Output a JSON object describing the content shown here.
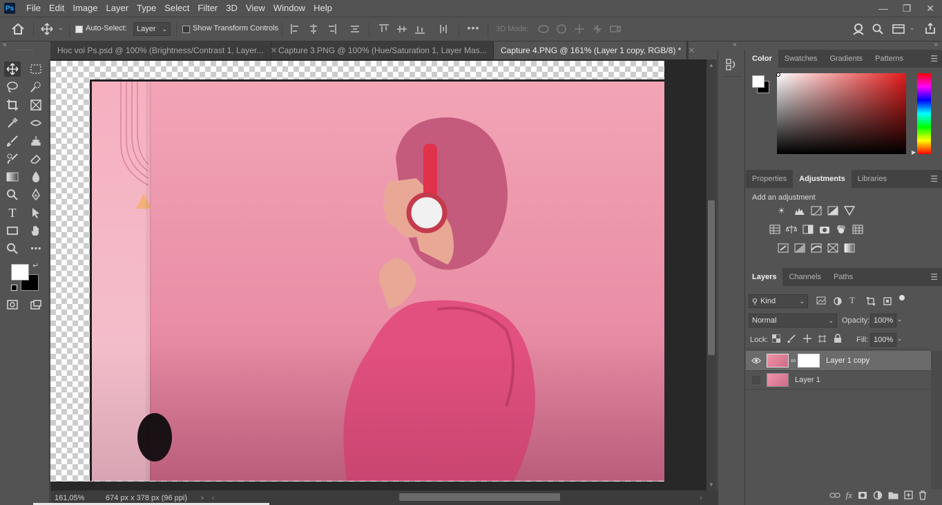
{
  "app": {
    "logo": "Ps"
  },
  "menu": [
    "File",
    "Edit",
    "Image",
    "Layer",
    "Type",
    "Select",
    "Filter",
    "3D",
    "View",
    "Window",
    "Help"
  ],
  "window_controls": [
    "minimize-icon",
    "restore-icon",
    "close-icon"
  ],
  "options": {
    "auto_select_label": "Auto-Select:",
    "auto_select_checked": true,
    "auto_select_target": "Layer",
    "show_transform_label": "Show Transform Controls",
    "show_transform_checked": false,
    "mode_3d_label": "3D Mode:"
  },
  "tabs": [
    {
      "label": "Hoc voi Ps.psd @ 100% (Brightness/Contrast 1, Layer...",
      "active": false
    },
    {
      "label": "Capture 3.PNG @ 100% (Hue/Saturation 1, Layer Mas...",
      "active": false
    },
    {
      "label": "Capture 4.PNG @ 161% (Layer 1 copy, RGB/8) *",
      "active": true
    }
  ],
  "status": {
    "zoom": "161,05%",
    "doc_info": "674 px x 378 px (96 ppi)"
  },
  "color_panel": {
    "tabs": [
      "Color",
      "Swatches",
      "Gradients",
      "Patterns"
    ],
    "active_tab": "Color",
    "foreground": "#ffffff",
    "background": "#000000"
  },
  "properties_panel": {
    "tabs": [
      "Properties",
      "Adjustments",
      "Libraries"
    ],
    "active_tab": "Adjustments",
    "hint": "Add an adjustment"
  },
  "layers_panel": {
    "tabs": [
      "Layers",
      "Channels",
      "Paths"
    ],
    "active_tab": "Layers",
    "filter_kind": "Kind",
    "blend_mode": "Normal",
    "opacity_label": "Opacity:",
    "opacity": "100%",
    "lock_label": "Lock:",
    "fill_label": "Fill:",
    "fill": "100%",
    "layers": [
      {
        "name": "Layer 1 copy",
        "visible": true,
        "selected": true,
        "has_mask": true
      },
      {
        "name": "Layer 1",
        "visible": false,
        "selected": false,
        "has_mask": false
      }
    ]
  },
  "colors": {
    "accent": "#31a8ff",
    "ui_bg": "#535353",
    "canvas_bg": "#282828",
    "photo_pink": "#ee95a9"
  }
}
